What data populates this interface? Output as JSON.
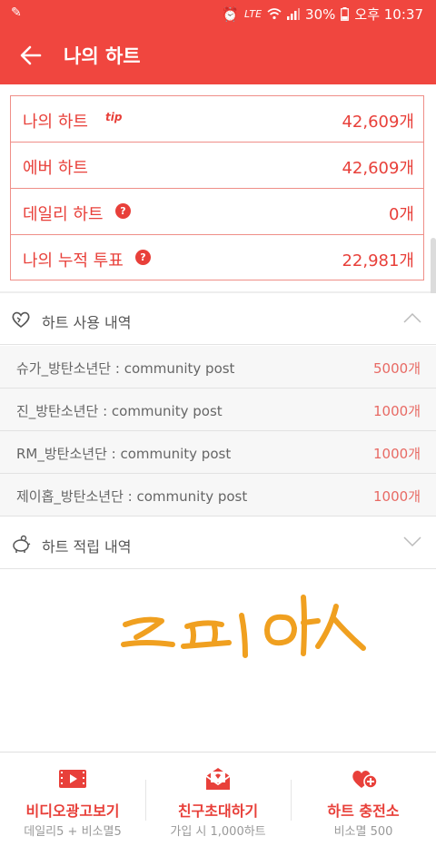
{
  "status_bar": {
    "battery": "30%",
    "time": "오후 10:37",
    "network": "LTE"
  },
  "header": {
    "title": "나의 하트"
  },
  "stats": [
    {
      "label": "나의 하트",
      "value": "42,609개",
      "badge": "tip"
    },
    {
      "label": "에버 하트",
      "value": "42,609개",
      "badge": ""
    },
    {
      "label": "데일리 하트",
      "value": "0개",
      "badge": "?"
    },
    {
      "label": "나의 누적 투표",
      "value": "22,981개",
      "badge": "?"
    }
  ],
  "usage_section": {
    "label": "하트 사용 내역",
    "items": [
      {
        "text": "슈가_방탄소년단 : community post",
        "amount": "5000개"
      },
      {
        "text": "진_방탄소년단 : community post",
        "amount": "1000개"
      },
      {
        "text": "RM_방탄소년단 : community post",
        "amount": "1000개"
      },
      {
        "text": "제이홉_방탄소년단 : community post",
        "amount": "1000개"
      }
    ]
  },
  "earn_section": {
    "label": "하트 적립 내역"
  },
  "bottom_bar": [
    {
      "title": "비디오광고보기",
      "subtitle": "데일리5 + 비소멸5",
      "icon": "video-icon"
    },
    {
      "title": "친구초대하기",
      "subtitle": "가입 시 1,000하트",
      "icon": "mail-icon"
    },
    {
      "title": "하트 충전소",
      "subtitle": "비소멸 500",
      "icon": "heart-plus-icon"
    }
  ],
  "colors": {
    "brand": "#f0463f",
    "accent_text": "#e8403a"
  }
}
